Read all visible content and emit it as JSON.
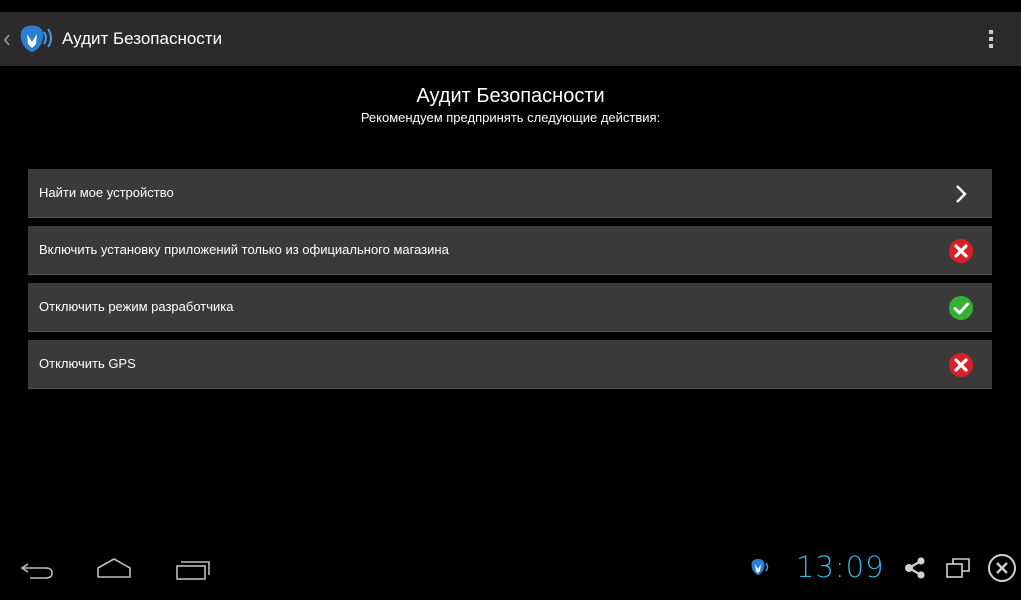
{
  "action_bar": {
    "title": "Аудит Безопасности"
  },
  "heading": {
    "title": "Аудит Безопасности",
    "subtitle": "Рекомендуем предпринять следующие действия:"
  },
  "items": [
    {
      "label": "Найти мое устройство",
      "status": "chevron"
    },
    {
      "label": "Включить установку приложений только из официального магазина",
      "status": "fail"
    },
    {
      "label": "Отключить режим разработчика",
      "status": "ok"
    },
    {
      "label": "Отключить GPS",
      "status": "fail"
    }
  ],
  "system_bar": {
    "clock": "13:09"
  },
  "colors": {
    "accent": "#33b5e5",
    "fail": "#d9202a",
    "ok": "#34b233",
    "row_bg": "#3a3a3a",
    "action_bar_bg": "#2b2b2b"
  }
}
